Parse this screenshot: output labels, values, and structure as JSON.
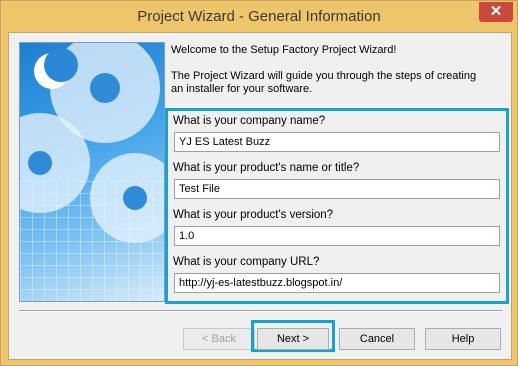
{
  "window": {
    "title": "Project Wizard - General Information",
    "close_glyph": "✕"
  },
  "intro": {
    "welcome": "Welcome to the Setup Factory Project Wizard!",
    "description": "The Project Wizard will guide you through the steps of creating an installer for your software."
  },
  "form": {
    "company_name_label": "What is your company name?",
    "company_name_value": "YJ ES Latest Buzz",
    "product_name_label": "What is your product's name or title?",
    "product_name_value": "Test File",
    "version_label": "What is your product's version?",
    "version_value": "1.0",
    "url_label": "What is your company URL?",
    "url_value": "http://yj-es-latestbuzz.blogspot.in/"
  },
  "buttons": {
    "back": "< Back",
    "next": "Next >",
    "cancel": "Cancel",
    "help": "Help"
  },
  "colors": {
    "highlight": "#17a2d6",
    "titlebar": "#efc56c",
    "close": "#c94a3a"
  }
}
